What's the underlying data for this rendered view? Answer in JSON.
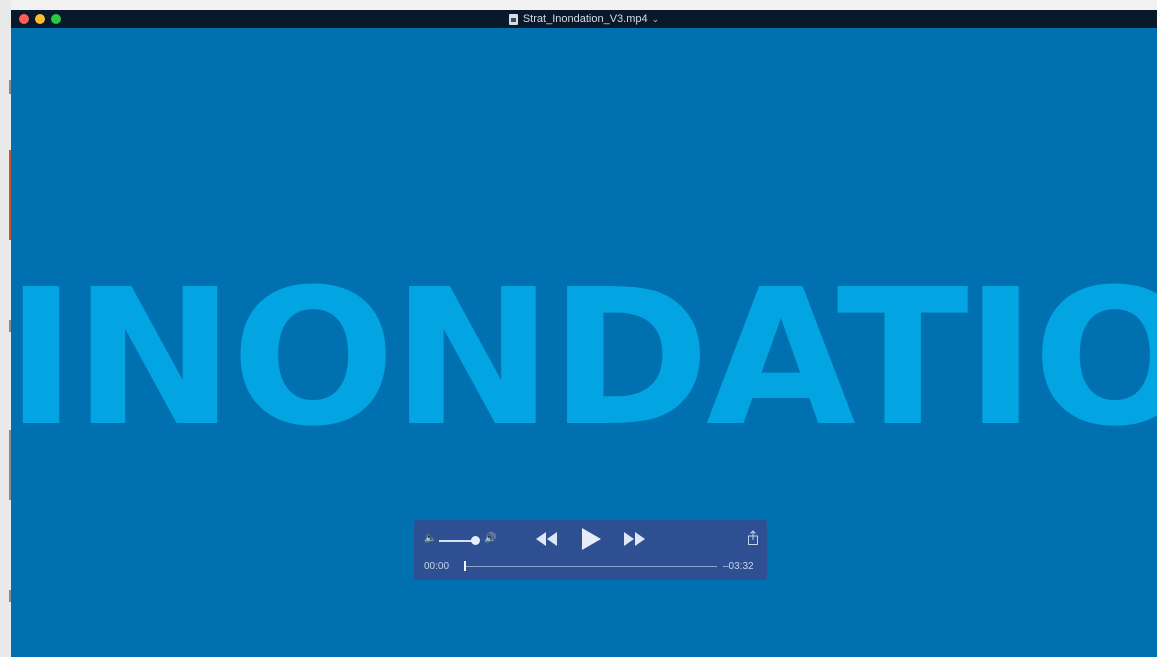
{
  "window": {
    "title": "Strat_Inondation_V3.mp4",
    "title_chevron_icon": "chevron-down-icon"
  },
  "video": {
    "frame_text": "INONDATION",
    "background_color": "#0070b1",
    "text_color": "#02a5e1"
  },
  "controls": {
    "volume_low_icon": "speaker-low-icon",
    "volume_high_icon": "speaker-high-icon",
    "volume_level": 1.0,
    "rewind_icon": "rewind-icon",
    "play_icon": "play-icon",
    "fast_forward_icon": "fast-forward-icon",
    "share_icon": "share-icon",
    "current_time": "00:00",
    "remaining_time": "–03:32",
    "playback_progress": 0.0
  }
}
